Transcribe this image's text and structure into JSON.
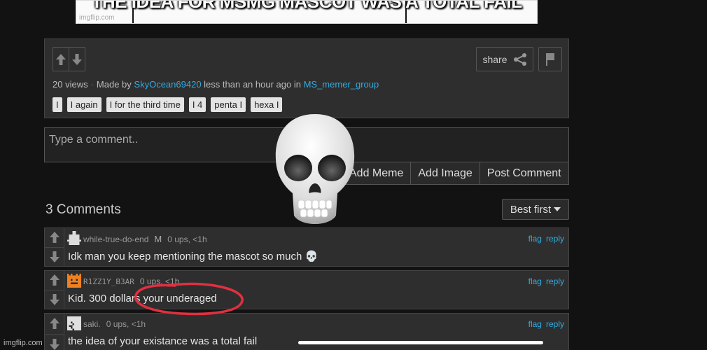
{
  "meme": {
    "caption": "THE IDEA FOR MSMG MASCOT WAS A TOTAL FAIL",
    "watermark": "imgflip.com"
  },
  "post": {
    "views": "20 views",
    "made_by_prefix": "Made by",
    "author": "SkyOcean69420",
    "time_text": "less than an hour ago in",
    "stream": "MS_memer_group",
    "share_label": "share",
    "tags": [
      "I",
      "I again",
      "I for the third time",
      "I 4",
      "penta I",
      "hexa I"
    ]
  },
  "comment_form": {
    "placeholder": "Type a comment..",
    "add_meme": "Add Meme",
    "add_image": "Add Image",
    "post_comment": "Post Comment"
  },
  "comments_header": {
    "count": "3 Comments",
    "sort": "Best first"
  },
  "comments": [
    {
      "user": "while-true-do-end",
      "badge": "M",
      "meta": "0 ups, <1h",
      "text": "Idk man you keep mentioning the mascot so much 💀",
      "avatar_color": "#dddddd",
      "flag": "flag",
      "reply": "reply"
    },
    {
      "user": "R1ZZ1Y_B3AR",
      "badge": "",
      "meta": "0 ups, <1h",
      "text": "Kid. 300 dollars your underaged",
      "avatar_color": "#f08020",
      "flag": "flag",
      "reply": "reply"
    },
    {
      "user": "saki.",
      "badge": "",
      "meta": "0 ups, <1h",
      "text": "the idea of your existance was a total fail",
      "avatar_color": "#e0e0e0",
      "flag": "flag",
      "reply": "reply"
    }
  ],
  "overlay": {
    "emoji": "💀",
    "watermark": "imgflip.com"
  },
  "colors": {
    "link": "#33aadd",
    "annotation": "#e03040"
  }
}
